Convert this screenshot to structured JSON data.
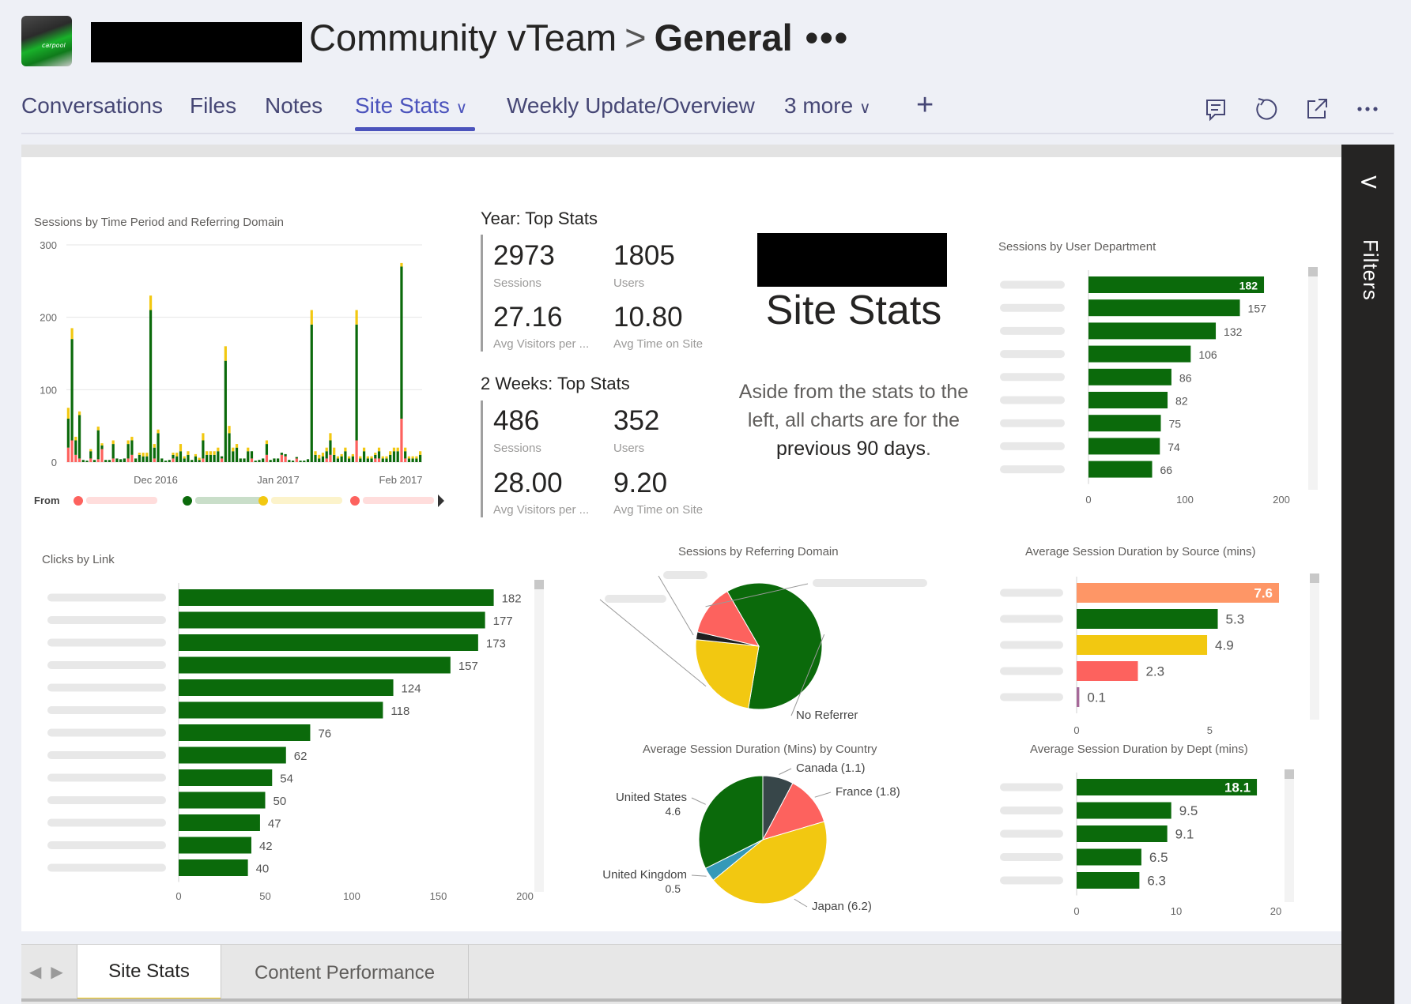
{
  "header": {
    "team_name": "Community vTeam",
    "separator": ">",
    "channel": "General",
    "more": "•••",
    "logo_text": "carpool"
  },
  "tabs": [
    {
      "label": "Conversations"
    },
    {
      "label": "Files"
    },
    {
      "label": "Notes"
    },
    {
      "label": "Site Stats",
      "chevron": "∨",
      "active": true
    },
    {
      "label": "Weekly Update/Overview"
    },
    {
      "label": "3 more",
      "chevron": "∨"
    }
  ],
  "header_icons": [
    "conversation-icon",
    "refresh-icon",
    "popout-icon",
    "more-options-icon"
  ],
  "add_tab": "+",
  "filters": {
    "label": "Filters",
    "chevron": "<"
  },
  "cards": {
    "year": {
      "title": "Year: Top Stats",
      "sessions": "2973",
      "sessions_label": "Sessions",
      "users": "1805",
      "users_label": "Users",
      "avg_visitors": "27.16",
      "avg_visitors_label": "Avg Visitors per ...",
      "avg_time": "10.80",
      "avg_time_label": "Avg Time on Site"
    },
    "weeks": {
      "title": "2 Weeks: Top Stats",
      "sessions": "486",
      "sessions_label": "Sessions",
      "users": "352",
      "users_label": "Users",
      "avg_visitors": "28.00",
      "avg_visitors_label": "Avg Visitors per ...",
      "avg_time": "9.20",
      "avg_time_label": "Avg Time on Site"
    }
  },
  "site_stats": {
    "title": "Site Stats",
    "text_line1": "Aside from the stats to the",
    "text_line2": "left, all charts are for the",
    "text_line3": "previous 90 days",
    "text_period": "."
  },
  "sheet_tabs": [
    {
      "label": "Site Stats",
      "active": true
    },
    {
      "label": "Content Performance"
    }
  ],
  "colors": {
    "green": "#0b6a0b",
    "yellow": "#f2c811",
    "red": "#fd625e",
    "orange": "#fe9666",
    "gray": "#374649",
    "blue": "#3599b8",
    "accent": "#4b53bc"
  },
  "chart_data": [
    {
      "id": "sessions-time",
      "type": "bar",
      "stacked": true,
      "title": "Sessions by Time Period and Referring Domain",
      "ylim": [
        0,
        300
      ],
      "yticks": [
        0,
        100,
        200,
        300
      ],
      "xticks": [
        "Dec 2016",
        "Jan 2017",
        "Feb 2017"
      ],
      "legend_title": "From",
      "legend_colors": [
        "#fd625e",
        "#0b6a0b",
        "#f2c811",
        "#fd625e"
      ],
      "series": [
        {
          "color": "#fd625e",
          "values": [
            20,
            30,
            10,
            5,
            0,
            0,
            5,
            0,
            4,
            18,
            0,
            0,
            5,
            0,
            0,
            0,
            5,
            10,
            0,
            0,
            0,
            0,
            0,
            5,
            0,
            0,
            0,
            0,
            5,
            0,
            0,
            0,
            0,
            0,
            0,
            0,
            5,
            0,
            0,
            0,
            0,
            5,
            0,
            0,
            0,
            0,
            0,
            0,
            0,
            5,
            0,
            0,
            0,
            10,
            0,
            0,
            0,
            10,
            8,
            0,
            0,
            5,
            0,
            0,
            0,
            0,
            0,
            0,
            0,
            5,
            10,
            0,
            0,
            0,
            0,
            0,
            0,
            30,
            0,
            0,
            0,
            0,
            5,
            5,
            0,
            0,
            0,
            0,
            0,
            60,
            5,
            0,
            0,
            0,
            0
          ]
        },
        {
          "color": "#0b6a0b",
          "values": [
            40,
            140,
            20,
            60,
            3,
            2,
            10,
            3,
            40,
            5,
            3,
            3,
            20,
            5,
            4,
            5,
            20,
            20,
            5,
            10,
            8,
            8,
            210,
            15,
            40,
            5,
            2,
            3,
            5,
            8,
            15,
            5,
            10,
            3,
            8,
            3,
            25,
            10,
            10,
            10,
            15,
            3,
            140,
            40,
            15,
            20,
            5,
            5,
            15,
            10,
            2,
            3,
            5,
            15,
            3,
            5,
            5,
            3,
            3,
            3,
            2,
            2,
            2,
            2,
            4,
            190,
            10,
            5,
            8,
            10,
            20,
            10,
            5,
            8,
            15,
            5,
            8,
            160,
            5,
            15,
            5,
            5,
            5,
            10,
            5,
            5,
            10,
            15,
            15,
            210,
            10,
            5,
            5,
            5,
            10
          ]
        },
        {
          "color": "#f2c811",
          "values": [
            15,
            15,
            5,
            5,
            0,
            0,
            3,
            0,
            5,
            3,
            0,
            0,
            5,
            0,
            0,
            0,
            5,
            5,
            0,
            3,
            5,
            5,
            20,
            5,
            5,
            0,
            0,
            0,
            3,
            5,
            10,
            3,
            5,
            0,
            3,
            3,
            10,
            5,
            5,
            5,
            5,
            0,
            20,
            10,
            5,
            5,
            0,
            0,
            5,
            0,
            0,
            0,
            0,
            5,
            0,
            0,
            0,
            0,
            0,
            0,
            0,
            0,
            0,
            0,
            0,
            20,
            5,
            5,
            5,
            5,
            10,
            10,
            3,
            3,
            5,
            3,
            3,
            20,
            3,
            5,
            3,
            3,
            3,
            5,
            3,
            3,
            5,
            5,
            5,
            5,
            5,
            3,
            3,
            3,
            5
          ]
        }
      ]
    },
    {
      "id": "sessions-dept",
      "type": "bar",
      "orientation": "horizontal",
      "title": "Sessions by User Department",
      "values": [
        182,
        157,
        132,
        106,
        86,
        82,
        75,
        74,
        66
      ],
      "xlim": [
        0,
        200
      ],
      "xticks": [
        0,
        100,
        200
      ]
    },
    {
      "id": "clicks-link",
      "type": "bar",
      "orientation": "horizontal",
      "title": "Clicks by Link",
      "values": [
        182,
        177,
        173,
        157,
        124,
        118,
        76,
        62,
        54,
        50,
        47,
        42,
        40
      ],
      "xlim": [
        0,
        200
      ],
      "xticks": [
        0,
        50,
        100,
        150,
        200
      ]
    },
    {
      "id": "sessions-domain",
      "type": "pie",
      "title": "Sessions by Referring Domain",
      "slices": [
        {
          "value": 61,
          "color": "#0b6a0b",
          "label": "No Referrer"
        },
        {
          "value": 24,
          "color": "#f2c811",
          "label": ""
        },
        {
          "value": 2,
          "color": "#1f1f1f",
          "label": ""
        },
        {
          "value": 13,
          "color": "#fd625e",
          "label": ""
        }
      ]
    },
    {
      "id": "duration-country",
      "type": "pie",
      "title": "Average Session Duration (Mins) by Country",
      "slices": [
        {
          "value": 1.1,
          "color": "#374649",
          "label": "Canada (1.1)"
        },
        {
          "value": 1.8,
          "color": "#fd625e",
          "label": "France (1.8)"
        },
        {
          "value": 6.2,
          "color": "#f2c811",
          "label": "Japan (6.2)"
        },
        {
          "value": 0.5,
          "color": "#3599b8",
          "label": "United Kingdom",
          "sub": "0.5"
        },
        {
          "value": 4.6,
          "color": "#0b6a0b",
          "label": "United States",
          "sub": "4.6"
        }
      ]
    },
    {
      "id": "duration-source",
      "type": "bar",
      "orientation": "horizontal",
      "title": "Average Session Duration by Source (mins)",
      "values": [
        7.6,
        5.3,
        4.9,
        2.3,
        0.1
      ],
      "colors": [
        "#fe9666",
        "#0b6a0b",
        "#f2c811",
        "#fd625e",
        "#a66999"
      ],
      "xlim": [
        0,
        7.6
      ],
      "xticks": [
        0,
        5
      ]
    },
    {
      "id": "duration-dept",
      "type": "bar",
      "orientation": "horizontal",
      "title": "Average Session Duration by Dept (mins)",
      "values": [
        18.1,
        9.5,
        9.1,
        6.5,
        6.3
      ],
      "xlim": [
        0,
        20
      ],
      "xticks": [
        0,
        10,
        20
      ]
    }
  ]
}
